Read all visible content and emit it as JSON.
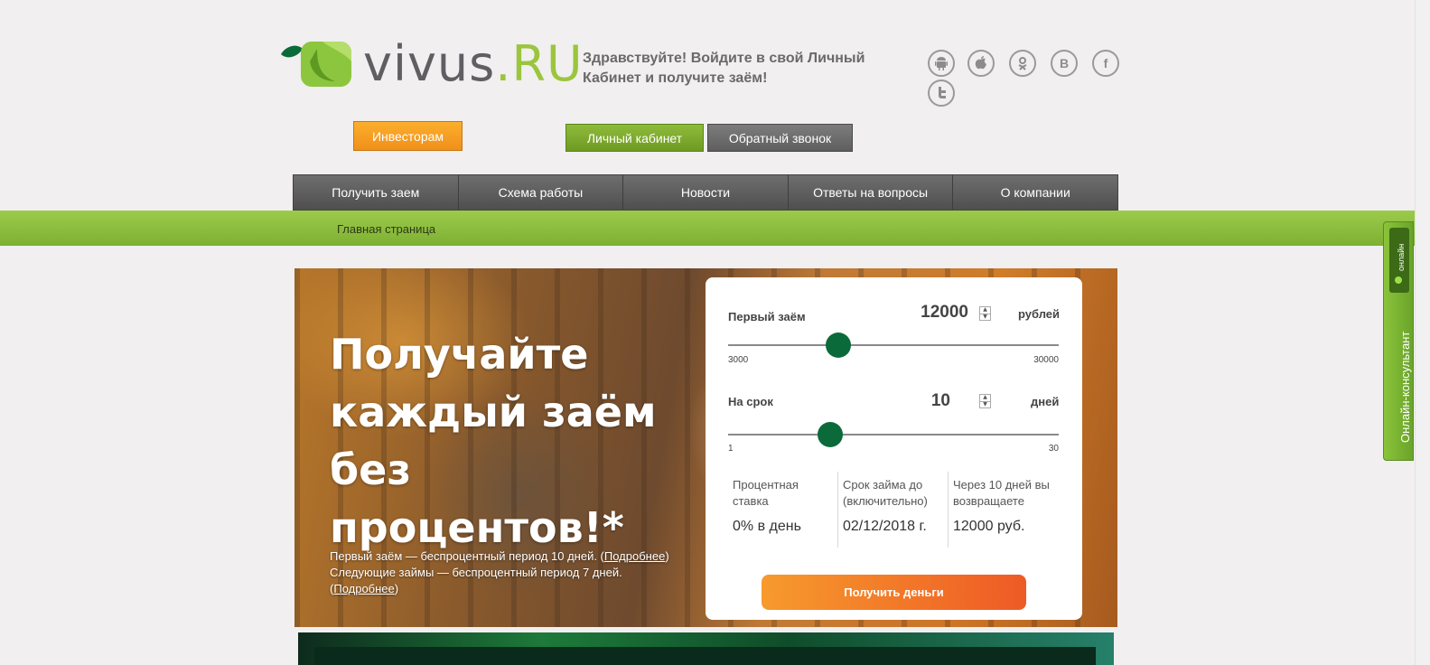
{
  "header": {
    "logo_main": "vivus",
    "logo_suffix": ".RU",
    "greeting": "Здравствуйте! Войдите в свой Личный Кабинет и получите заём!"
  },
  "social": [
    {
      "name": "android-icon",
      "glyph": ""
    },
    {
      "name": "apple-icon",
      "glyph": ""
    },
    {
      "name": "odnoklassniki-icon",
      "glyph": ""
    },
    {
      "name": "vkontakte-icon",
      "glyph": "B"
    },
    {
      "name": "facebook-icon",
      "glyph": "f"
    },
    {
      "name": "twitter-icon",
      "glyph": ""
    }
  ],
  "buttons": {
    "investors": "Инвесторам",
    "cabinet": "Личный кабинет",
    "callback": "Обратный звонок"
  },
  "nav": [
    "Получить заем",
    "Схема работы",
    "Новости",
    "Ответы на вопросы",
    "О компании"
  ],
  "breadcrumb": "Главная страница",
  "hero": {
    "title_lines": [
      "Получайте",
      "каждый заём",
      "без процентов!*"
    ],
    "note_1": "Первый заём — беспроцентный период 10 дней. (",
    "note_1_link": "Подробнее",
    "note_1_end": ")",
    "note_2": "Следующие займы — беспроцентный период 7 дней. (",
    "note_2_link": "Подробнее",
    "note_2_end": ")"
  },
  "calculator": {
    "amount_label": "Первый заём",
    "amount_value": "12000",
    "amount_unit": "рублей",
    "amount_min": "3000",
    "amount_max": "30000",
    "amount_fraction": 0.333,
    "term_label": "На срок",
    "term_value": "10",
    "term_unit": "дней",
    "term_min": "1",
    "term_max": "30",
    "term_fraction": 0.31,
    "rate_title": "Процентная ставка",
    "rate_value": "0% в день",
    "until_title": "Срок займа до (включительно)",
    "until_value": "02/12/2018 г.",
    "return_title": "Через 10 дней вы возвращаете",
    "return_value": "12000 руб.",
    "submit": "Получить деньги"
  },
  "side_tab": {
    "status": "онлайн",
    "label": "Онлайн-консультант"
  },
  "colors": {
    "brand_green": "#9bc53d",
    "slider_thumb": "#0b6a3a",
    "orange": "#f0901a"
  }
}
